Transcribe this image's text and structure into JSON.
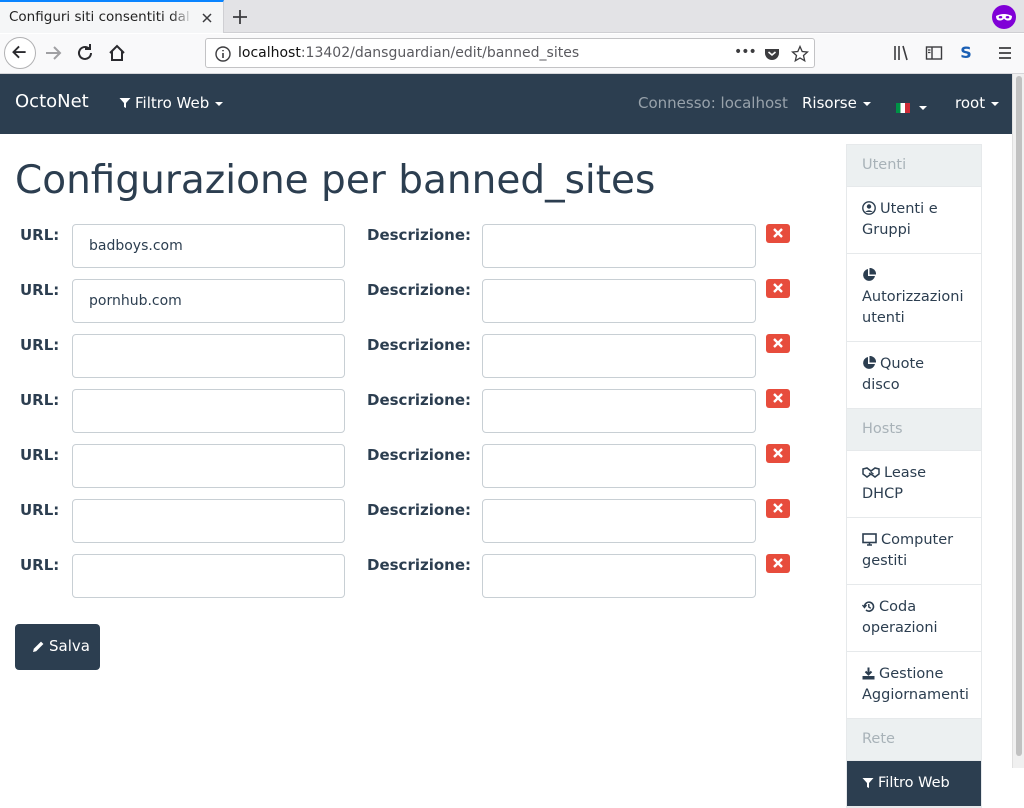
{
  "browser": {
    "tab_title": "Configuri siti consentiti dal filtro",
    "url_host": "localhost",
    "url_rest": ":13402/dansguardian/edit/banned_sites",
    "url_ellipsis": "•••",
    "extension_label": "S"
  },
  "navbar": {
    "brand": "OctoNet",
    "filter_menu": "Filtro Web",
    "connected": "Connesso: localhost",
    "resources_menu": "Risorse",
    "user_menu": "root"
  },
  "main": {
    "title": "Configurazione per banned_sites",
    "url_label": "URL:",
    "desc_label": "Descrizione:",
    "rows": [
      {
        "url": "badboys.com",
        "desc": ""
      },
      {
        "url": "pornhub.com",
        "desc": ""
      },
      {
        "url": "",
        "desc": ""
      },
      {
        "url": "",
        "desc": ""
      },
      {
        "url": "",
        "desc": ""
      },
      {
        "url": "",
        "desc": ""
      },
      {
        "url": "",
        "desc": ""
      }
    ],
    "save_label": "Salva"
  },
  "sidebar": {
    "utenti_header": "Utenti",
    "users_groups": "Utenti e Gruppi",
    "user_auth": "Autorizzazioni utenti",
    "disk_quota": "Quote disco",
    "hosts_header": "Hosts",
    "dhcp_lease": "Lease DHCP",
    "managed_computers": "Computer gestiti",
    "operations_queue": "Coda operazioni",
    "update_management": "Gestione Aggiornamenti",
    "rete_header": "Rete",
    "web_filter": "Filtro Web"
  },
  "colors": {
    "navbar_bg": "#2c3e50",
    "danger": "#e74c3c",
    "sidebar_header_bg": "#ecf0f1"
  }
}
